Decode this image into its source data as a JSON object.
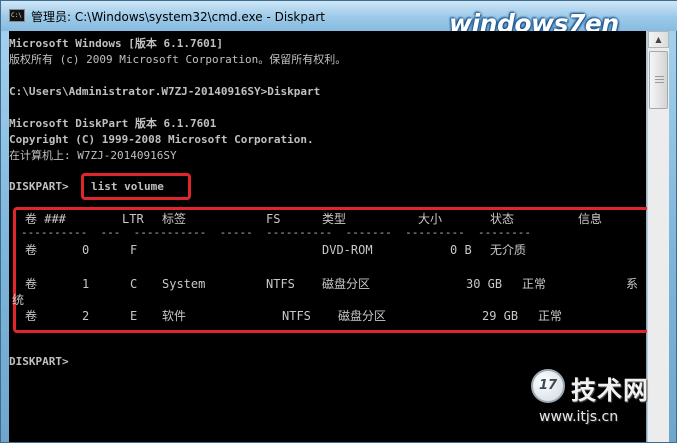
{
  "window": {
    "title": "管理员: C:\\Windows\\system32\\cmd.exe - Diskpart",
    "icon_label": "C:\\",
    "brand_logo": "windows7en",
    "controls": {
      "minimize": "–",
      "maximize": "□",
      "close": "✕"
    }
  },
  "console": {
    "lines": [
      "Microsoft Windows [版本 6.1.7601]",
      "版权所有 (c) 2009 Microsoft Corporation。保留所有权利。",
      "",
      "C:\\Users\\Administrator.W7ZJ-20140916SY>Diskpart",
      "",
      "Microsoft DiskPart 版本 6.1.7601",
      "Copyright (C) 1999-2008 Microsoft Corporation.",
      "在计算机上: W7ZJ-20140916SY",
      "",
      "DISKPART>"
    ],
    "command": "list volume",
    "final_prompt": "DISKPART>"
  },
  "volume_table": {
    "headers": [
      "卷 ###",
      "LTR",
      "标签",
      "FS",
      "类型",
      "大小",
      "状态",
      "信息"
    ],
    "dashes": "----------  ---  -----------  -----  ----------  -------  ---------  --------",
    "rows": [
      {
        "vol": "卷",
        "num": "0",
        "ltr": "F",
        "label": "",
        "fs": "",
        "type": "DVD-ROM",
        "size": "0 B",
        "status": "无介质",
        "info": ""
      },
      {
        "vol": "卷",
        "num": "1",
        "ltr": "C",
        "label": "System",
        "fs": "NTFS",
        "type": "磁盘分区",
        "size": "30 GB",
        "status": "正常",
        "info": "系统"
      },
      {
        "vol": "卷",
        "num": "2",
        "ltr": "E",
        "label": "软件",
        "fs": "NTFS",
        "type": "磁盘分区",
        "size": "29 GB",
        "status": "正常",
        "info": ""
      }
    ]
  },
  "watermark": {
    "logo_text": "17",
    "name": "技术网",
    "url": "www.itjs.cn"
  },
  "colors": {
    "console_bg": "#000000",
    "console_text": "#c0c0c0",
    "highlight_red": "#e0262a",
    "titlebar": "#9fcbe9"
  }
}
